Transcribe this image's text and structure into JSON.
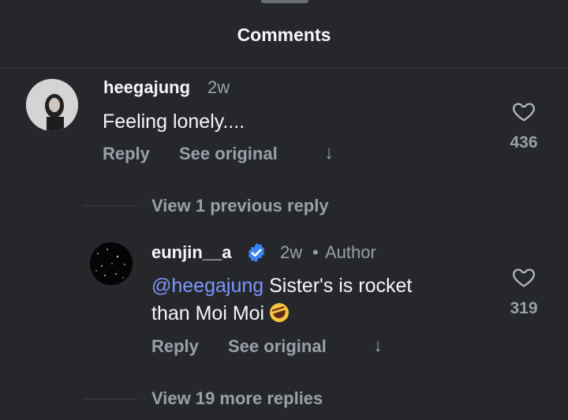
{
  "header": {
    "title": "Comments"
  },
  "comments": [
    {
      "username": "heegajung",
      "time": "2w",
      "text": "Feeling lonely....",
      "reply_label": "Reply",
      "see_original_label": "See original",
      "likes": "436",
      "avatar_icon": "user-avatar"
    }
  ],
  "thread": {
    "view_previous_label": "View 1 previous reply",
    "reply": {
      "username": "eunjin__a",
      "verified": true,
      "time": "2w",
      "separator": "•",
      "author_label": "Author",
      "mention": "@heegajung",
      "text_line1": " Sister's is rocket",
      "text_line2": "than Moi Moi",
      "emoji": "rolling-on-floor-laughing",
      "reply_label": "Reply",
      "see_original_label": "See original",
      "likes": "319"
    },
    "view_more_label": "View 19 more replies"
  },
  "colors": {
    "background": "#25272b",
    "muted": "#9aa0a6",
    "mention": "#7f95ff",
    "verified": "#3b82f6"
  }
}
